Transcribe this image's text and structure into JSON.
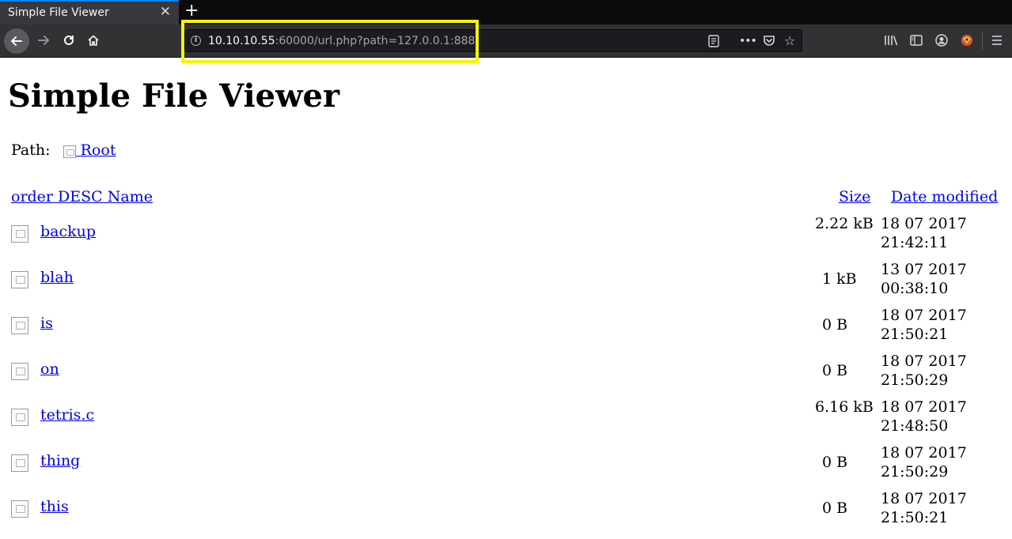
{
  "browser": {
    "tab_title": "Simple File Viewer",
    "tab_close": "✕",
    "new_tab": "+",
    "url_host": "10.10.10.55",
    "url_rest": ":60000/url.php?path=127.0.0.1:888",
    "icons": [
      "back-arrow-icon",
      "forward-arrow-icon",
      "reload-icon",
      "home-icon",
      "info-icon",
      "reader-view-icon",
      "more-icon",
      "pocket-icon",
      "bookmark-star-icon",
      "library-icon",
      "sidebar-icon",
      "account-icon",
      "extension-icon",
      "hamburger-menu-icon"
    ],
    "highlight_color": "#f5f500"
  },
  "page": {
    "title": "Simple File Viewer",
    "path_label": "Path:",
    "root_link": "Root",
    "header": {
      "name": "order DESC Name",
      "size": "Size",
      "date": "Date modified"
    },
    "files": [
      {
        "name": "backup",
        "size": "2.22 kB",
        "date": "18 07 2017 21:42:11"
      },
      {
        "name": "blah",
        "size": "1 kB",
        "date": "13 07 2017 00:38:10"
      },
      {
        "name": "is",
        "size": "0 B",
        "date": "18 07 2017 21:50:21"
      },
      {
        "name": "on",
        "size": "0 B",
        "date": "18 07 2017 21:50:29"
      },
      {
        "name": "tetris.c",
        "size": "6.16 kB",
        "date": "18 07 2017 21:48:50"
      },
      {
        "name": "thing",
        "size": "0 B",
        "date": "18 07 2017 21:50:29"
      },
      {
        "name": "this",
        "size": "0 B",
        "date": "18 07 2017 21:50:21"
      }
    ],
    "link_color": "#0000ee"
  }
}
